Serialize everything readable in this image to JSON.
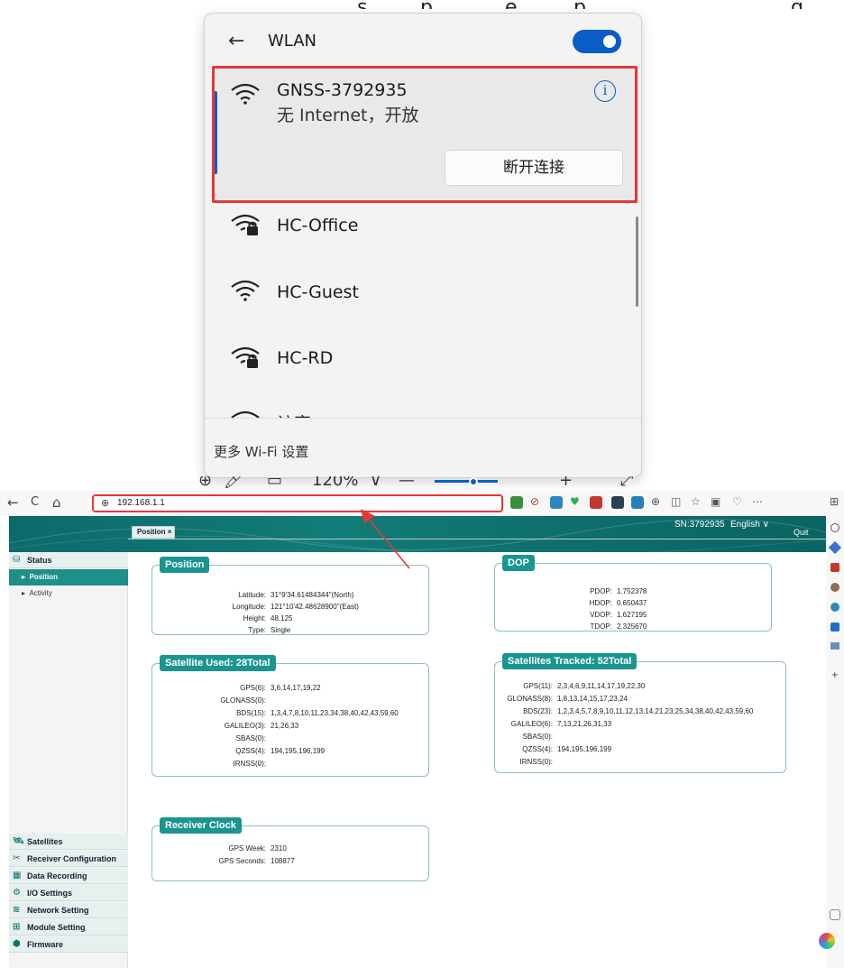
{
  "top_text": {
    "fragments": [
      "，",
      "s",
      "p",
      "e",
      "p",
      "g"
    ]
  },
  "wlan": {
    "back_glyph": "←",
    "title": "WLAN",
    "networks": [
      {
        "name": "GNSS-3792935",
        "status": "无 Internet，开放",
        "secured": false
      },
      {
        "name": "HC-Office",
        "secured": true
      },
      {
        "name": "HC-Guest",
        "secured": false
      },
      {
        "name": "HC-RD",
        "secured": true
      },
      {
        "name": "访客",
        "secured": false
      }
    ],
    "disconnect_label": "断开连接",
    "info_glyph": "i",
    "footer": "更多 Wi-Fi 设置"
  },
  "zoom_row": {
    "zoom_level": "120%",
    "glyphs": [
      "⊕",
      "🖊",
      "▭",
      "∨",
      "—",
      "+",
      "⤢"
    ]
  },
  "browser": {
    "nav": {
      "back": "←",
      "reload": "C",
      "home": "⌂"
    },
    "globe_glyph": "⊕",
    "url": "192.168.1.1",
    "ext_glyphs": [
      "⊘",
      "♥",
      "⊕",
      "◫",
      "☆",
      "▣",
      "♡",
      "⋯",
      "⊞"
    ]
  },
  "app": {
    "sn": "SN:3792935",
    "language": "English ∨",
    "quit": "Quit",
    "colors": {
      "header": "#127b78",
      "accent": "#1a9590",
      "active": "#1e8f8a"
    },
    "sidebar": {
      "status": "Status",
      "position": "Position",
      "activity": "Activity",
      "bottom_items": [
        {
          "icon": "🛰",
          "label": "Satellites"
        },
        {
          "icon": "✂",
          "label": "Receiver Configuration"
        },
        {
          "icon": "▦",
          "label": "Data Recording"
        },
        {
          "icon": "⚙",
          "label": "I/O Settings"
        },
        {
          "icon": "≋",
          "label": "Network Setting"
        },
        {
          "icon": "⊞",
          "label": "Module Setting"
        },
        {
          "icon": "⬢",
          "label": "Firmware"
        }
      ]
    },
    "tab": "Position ×",
    "position_card": {
      "title": "Position",
      "rows": [
        {
          "k": "Latitude:",
          "v": "31°9'34.61484344\"(North)"
        },
        {
          "k": "Longitude:",
          "v": "121°10'42.48628900\"(East)"
        },
        {
          "k": "Height:",
          "v": "48.125"
        },
        {
          "k": "Type:",
          "v": "Single"
        }
      ]
    },
    "dop_card": {
      "title": "DOP",
      "rows": [
        {
          "k": "PDOP:",
          "v": "1.752378"
        },
        {
          "k": "HDOP:",
          "v": "0.650437"
        },
        {
          "k": "VDOP:",
          "v": "1.627195"
        },
        {
          "k": "TDOP:",
          "v": "2.325670"
        }
      ]
    },
    "sat_used_card": {
      "title": "Satellite Used:  28Total",
      "rows": [
        {
          "k": "GPS(6):",
          "v": "3,6,14,17,19,22"
        },
        {
          "k": "GLONASS(0):",
          "v": ""
        },
        {
          "k": "BDS(15):",
          "v": "1,3,4,7,8,10,11,23,34,38,40,42,43,59,60"
        },
        {
          "k": "GALILEO(3):",
          "v": "21,26,33"
        },
        {
          "k": "SBAS(0):",
          "v": ""
        },
        {
          "k": "QZSS(4):",
          "v": "194,195,196,199"
        },
        {
          "k": "IRNSS(0):",
          "v": ""
        }
      ]
    },
    "sat_tracked_card": {
      "title": "Satellites Tracked:  52Total",
      "rows": [
        {
          "k": "GPS(11):",
          "v": "2,3,4,6,9,11,14,17,19,22,30"
        },
        {
          "k": "GLONASS(8):",
          "v": "1,8,13,14,15,17,23,24"
        },
        {
          "k": "BDS(23):",
          "v": "1,2,3,4,5,7,8,9,10,11,12,13,14,21,23,25,34,38,40,42,43,59,60"
        },
        {
          "k": "GALILEO(6):",
          "v": "7,13,21,26,31,33"
        },
        {
          "k": "SBAS(0):",
          "v": ""
        },
        {
          "k": "QZSS(4):",
          "v": "194,195,196,199"
        },
        {
          "k": "IRNSS(0):",
          "v": ""
        }
      ]
    },
    "clock_card": {
      "title": "Receiver Clock",
      "rows": [
        {
          "k": "GPS Week:",
          "v": "2310"
        },
        {
          "k": "GPS Seconds:",
          "v": "108877"
        }
      ]
    }
  }
}
